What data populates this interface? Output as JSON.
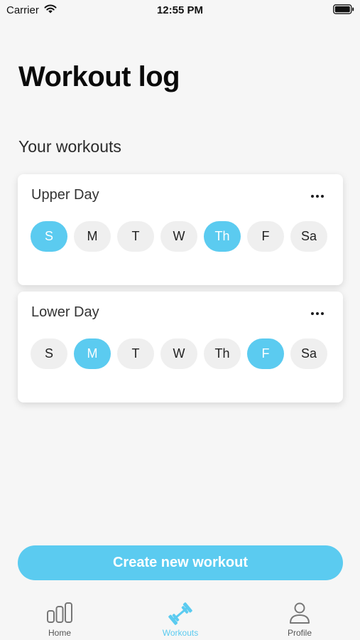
{
  "status_bar": {
    "carrier": "Carrier",
    "time": "12:55 PM"
  },
  "page": {
    "title": "Workout log",
    "section_title": "Your workouts"
  },
  "workouts": [
    {
      "name": "Upper Day",
      "days": [
        {
          "label": "S",
          "selected": true
        },
        {
          "label": "M",
          "selected": false
        },
        {
          "label": "T",
          "selected": false
        },
        {
          "label": "W",
          "selected": false
        },
        {
          "label": "Th",
          "selected": true
        },
        {
          "label": "F",
          "selected": false
        },
        {
          "label": "Sa",
          "selected": false
        }
      ]
    },
    {
      "name": "Lower Day",
      "days": [
        {
          "label": "S",
          "selected": false
        },
        {
          "label": "M",
          "selected": true
        },
        {
          "label": "T",
          "selected": false
        },
        {
          "label": "W",
          "selected": false
        },
        {
          "label": "Th",
          "selected": false
        },
        {
          "label": "F",
          "selected": true
        },
        {
          "label": "Sa",
          "selected": false
        }
      ]
    }
  ],
  "actions": {
    "create_label": "Create new workout"
  },
  "tab_bar": {
    "items": [
      {
        "label": "Home",
        "icon": "bar-chart-icon",
        "active": false
      },
      {
        "label": "Workouts",
        "icon": "dumbbell-icon",
        "active": true
      },
      {
        "label": "Profile",
        "icon": "person-icon",
        "active": false
      }
    ]
  },
  "colors": {
    "accent": "#5bcbf0",
    "pill_inactive": "#efefef",
    "background": "#f6f6f6"
  }
}
